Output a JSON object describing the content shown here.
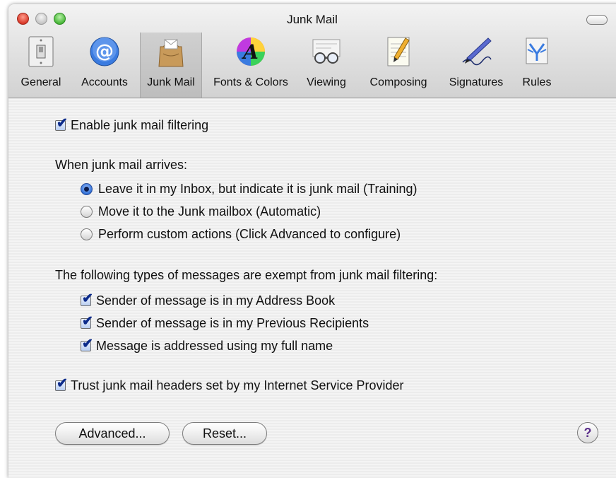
{
  "window": {
    "title": "Junk Mail"
  },
  "toolbar": {
    "items": [
      {
        "label": "General",
        "icon": "light-switch-icon"
      },
      {
        "label": "Accounts",
        "icon": "at-sign-icon"
      },
      {
        "label": "Junk Mail",
        "icon": "junk-mail-bag-icon"
      },
      {
        "label": "Fonts & Colors",
        "icon": "font-color-wheel-icon"
      },
      {
        "label": "Viewing",
        "icon": "glasses-icon"
      },
      {
        "label": "Composing",
        "icon": "notepad-pencil-icon"
      },
      {
        "label": "Signatures",
        "icon": "signature-pen-icon"
      },
      {
        "label": "Rules",
        "icon": "rules-funnel-icon"
      }
    ],
    "selected": "Junk Mail"
  },
  "settings": {
    "enable_filtering": {
      "label": "Enable junk mail filtering",
      "checked": true
    },
    "arrival_heading": "When junk mail arrives:",
    "arrival_options": [
      {
        "label": "Leave it in my Inbox, but indicate it is junk mail (Training)",
        "selected": true
      },
      {
        "label": "Move it to the Junk mailbox (Automatic)",
        "selected": false
      },
      {
        "label": "Perform custom actions (Click Advanced to configure)",
        "selected": false
      }
    ],
    "exempt_heading": "The following types of messages are exempt from junk mail filtering:",
    "exempt_options": [
      {
        "label": "Sender of message is in my Address Book",
        "checked": true
      },
      {
        "label": "Sender of message is in my Previous Recipients",
        "checked": true
      },
      {
        "label": "Message is addressed using my full name",
        "checked": true
      }
    ],
    "trust_headers": {
      "label": "Trust junk mail headers set by my Internet Service Provider",
      "checked": true
    }
  },
  "buttons": {
    "advanced": "Advanced...",
    "reset": "Reset...",
    "help": "?"
  },
  "colors": {
    "accent": "#2f6fd6",
    "check": "#0b2a8a",
    "help_mark": "#5a2d8a"
  }
}
